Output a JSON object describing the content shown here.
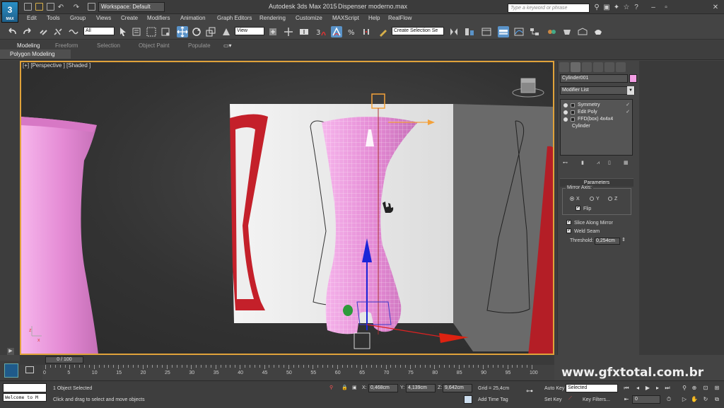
{
  "app": {
    "logo_text": "3",
    "logo_sub": "MAX",
    "title": "Autodesk 3ds Max  2015",
    "file": "Dispenser moderno.max",
    "workspace": "Workspace: Default",
    "search_placeholder": "Type a keyword or phrase"
  },
  "menu": [
    "Edit",
    "Tools",
    "Group",
    "Views",
    "Create",
    "Modifiers",
    "Animation",
    "Graph Editors",
    "Rendering",
    "Customize",
    "MAXScript",
    "Help",
    "RealFlow"
  ],
  "toolbar": {
    "selection_filter": "All",
    "reference_coord": "View",
    "named_selection": "Create Selection Se"
  },
  "ribbon": {
    "tabs": [
      "Modeling",
      "Freeform",
      "Selection",
      "Object Paint",
      "Populate"
    ],
    "active_tab": "Modeling",
    "sub_label": "Polygon Modeling"
  },
  "viewport": {
    "label": "[+] [Perspective ] [Shaded ]"
  },
  "command_panel": {
    "object_name": "Cylinder001",
    "object_color": "#f39ee4",
    "modifier_list": "Modifier List",
    "stack": [
      {
        "label": "Symmetry",
        "checked": true
      },
      {
        "label": "Edit Poly",
        "checked": true
      },
      {
        "label": "FFD(box) 4x4x4",
        "checked": false
      },
      {
        "label": "Cylinder",
        "checked": false
      }
    ],
    "params_title": "Parameters",
    "mirror_axis_label": "Mirror Axis:",
    "axes": [
      "X",
      "Y",
      "Z"
    ],
    "selected_axis": "X",
    "flip_label": "Flip",
    "slice_label": "Slice Along Mirror",
    "weld_label": "Weld Seam",
    "threshold_label": "Threshold:",
    "threshold_value": "0,254cm"
  },
  "timeline": {
    "slider_text": "0 / 100",
    "ticks": [
      0,
      5,
      10,
      15,
      20,
      25,
      30,
      35,
      40,
      45,
      50,
      55,
      60,
      65,
      70,
      75,
      80,
      85,
      90,
      95,
      100
    ],
    "watermark": "www.gfxtotal.com.br"
  },
  "status": {
    "maxscript": "Welcome to M",
    "selected_count": "1 Object Selected",
    "prompt": "Click and drag to select and move objects",
    "x_label": "X:",
    "x_value": "0,468cm",
    "y_label": "Y:",
    "y_value": "4,139cm",
    "z_label": "Z:",
    "z_value": "9,642cm",
    "grid": "Grid = 25,4cm",
    "add_time_tag": "Add Time Tag",
    "auto_key": "Auto Key",
    "set_key": "Set Key",
    "key_mode": "Selected",
    "key_filters": "Key Filters...",
    "frame": "0"
  },
  "colors": {
    "accent": "#e0a23a",
    "vase_pink": "#f39ee4",
    "active_tool": "#5a93c9",
    "dispenser_red": "#c4202a"
  }
}
